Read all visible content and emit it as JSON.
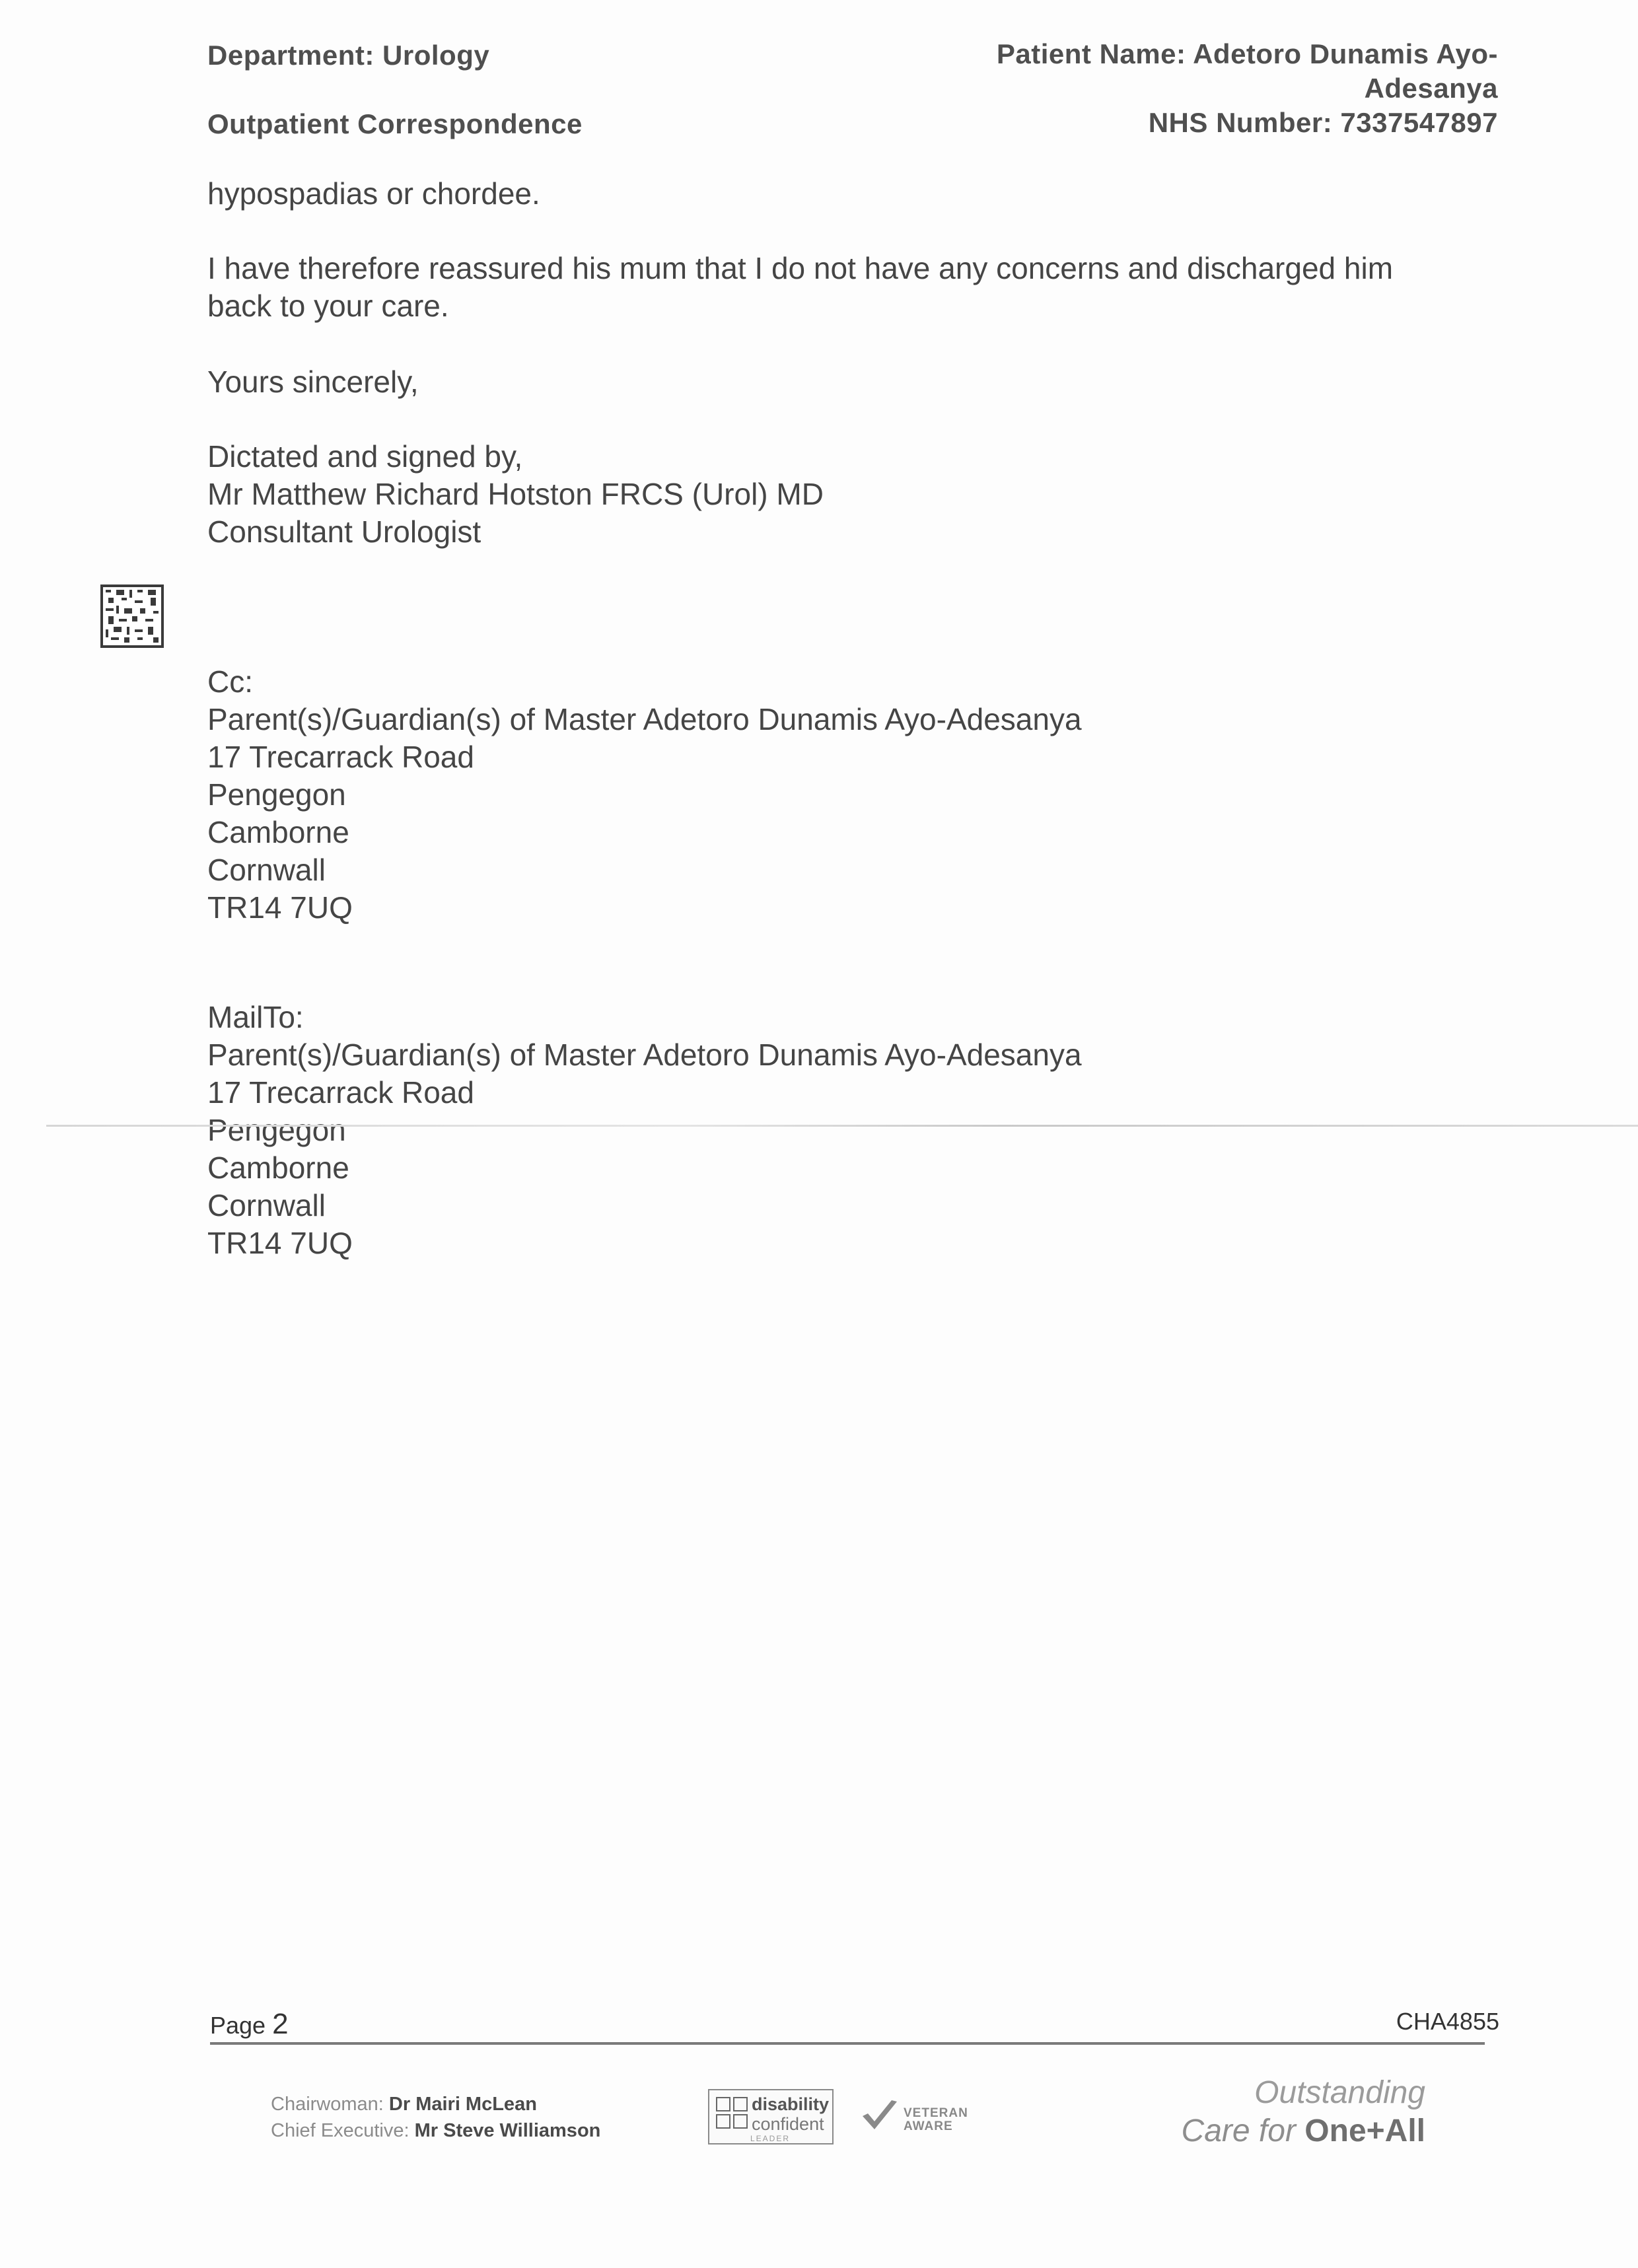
{
  "header": {
    "department": "Department: Urology",
    "correspondence": "Outpatient Correspondence",
    "patient_name_line1": "Patient Name: Adetoro Dunamis Ayo-",
    "patient_name_line2": "Adesanya",
    "nhs_number": "NHS Number: 7337547897"
  },
  "letter": {
    "continuation": "hypospadias or chordee.",
    "reassurance_line1": "I have therefore reassured his mum that I do not have any concerns and discharged him",
    "reassurance_line2": "back to your care.",
    "closing": "Yours sincerely,",
    "signature": {
      "dictated": "Dictated and signed by,",
      "name": "Mr Matthew Richard Hotston FRCS (Urol) MD",
      "title": "Consultant Urologist"
    }
  },
  "cc": {
    "label": "Cc:",
    "lines": [
      "Parent(s)/Guardian(s) of Master Adetoro Dunamis Ayo-Adesanya",
      "17 Trecarrack Road",
      "Pengegon",
      "Camborne",
      "Cornwall",
      "TR14 7UQ"
    ]
  },
  "mailto": {
    "label": "MailTo:",
    "lines": [
      "Parent(s)/Guardian(s) of Master Adetoro Dunamis Ayo-Adesanya",
      "17 Trecarrack Road",
      "Pengegon",
      "Camborne",
      "Cornwall",
      "TR14 7UQ"
    ]
  },
  "page_footer": {
    "page_label": "Page",
    "page_number": "2",
    "reference": "CHA4855"
  },
  "trust_footer": {
    "chair_label": "Chairwoman:",
    "chair_name": "Dr Mairi McLean",
    "ceo_label": "Chief Executive:",
    "ceo_name": "Mr Steve Williamson",
    "badge_disability_1": "disability",
    "badge_disability_2": "confident",
    "badge_disability_3": "LEADER",
    "badge_veteran_1": "VETERAN",
    "badge_veteran_2": "AWARE",
    "tagline_1": "Outstanding",
    "tagline_2a": "Care for ",
    "tagline_2b": "One+All"
  }
}
